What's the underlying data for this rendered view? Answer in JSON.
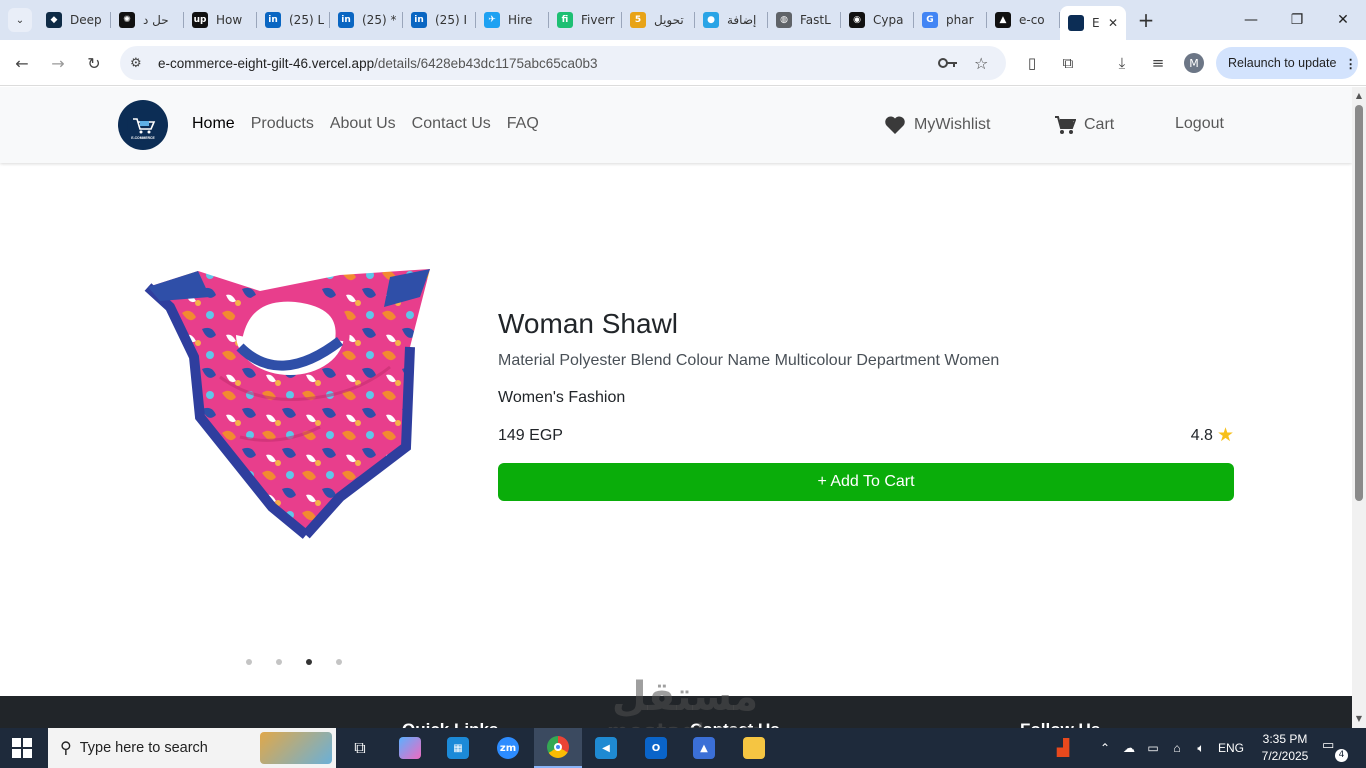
{
  "browser": {
    "tabs": [
      {
        "label": "Deep",
        "icon": "deepl-icon",
        "color": "#0f2b46",
        "glyph": "◆"
      },
      {
        "label": "حل د",
        "icon": "chatgpt-icon",
        "color": "#111111",
        "glyph": "✺"
      },
      {
        "label": "How",
        "icon": "upwork-icon",
        "color": "#111111",
        "glyph": "up"
      },
      {
        "label": "(25) L",
        "icon": "linkedin-icon",
        "color": "#0a66c2",
        "glyph": "in"
      },
      {
        "label": "(25) *",
        "icon": "linkedin-icon",
        "color": "#0a66c2",
        "glyph": "in"
      },
      {
        "label": "(25) I",
        "icon": "linkedin-icon",
        "color": "#0a66c2",
        "glyph": "in"
      },
      {
        "label": "Hire",
        "icon": "hire-icon",
        "color": "#1da1f2",
        "glyph": "✈"
      },
      {
        "label": "Fiverr",
        "icon": "fiverr-icon",
        "color": "#1dbf73",
        "glyph": "fi"
      },
      {
        "label": "تحويل",
        "icon": "khamsat-icon",
        "color": "#e8a317",
        "glyph": "5"
      },
      {
        "label": "إضافة",
        "icon": "mostaql-icon",
        "color": "#2aa4e6",
        "glyph": "●"
      },
      {
        "label": "FastL",
        "icon": "globe-icon",
        "color": "#5f6368",
        "glyph": "◍"
      },
      {
        "label": "Cypa",
        "icon": "github-icon",
        "color": "#111111",
        "glyph": "◉"
      },
      {
        "label": "phar",
        "icon": "google-icon",
        "color": "#4285f4",
        "glyph": "G"
      },
      {
        "label": "e-co",
        "icon": "vercel-icon",
        "color": "#111111",
        "glyph": "▲"
      }
    ],
    "active_tab": {
      "label": "E",
      "icon": "ecommerce-tab-icon",
      "color": "#0c2d55"
    },
    "url_host": "e-commerce-eight-gilt-46.vercel.app",
    "url_path": "/details/6428eb43dc1175abc65ca0b3",
    "avatar_letter": "M",
    "relaunch_label": "Relaunch to update"
  },
  "site": {
    "nav": {
      "links": [
        "Home",
        "Products",
        "About Us",
        "Contact Us",
        "FAQ"
      ],
      "active": "Home",
      "wishlist": "MyWishlist",
      "cart": "Cart",
      "logout": "Logout"
    },
    "logo_text": "E-COMMERCE"
  },
  "product": {
    "title": "Woman Shawl",
    "description": "Material Polyester Blend Colour Name Multicolour Department Women",
    "category": "Women's Fashion",
    "price": "149 EGP",
    "rating": "4.8",
    "add_to_cart": "+ Add To Cart",
    "slider_dots": 4,
    "active_dot": 3,
    "accent_color": "#0aad0a",
    "star_color": "#f7c01a"
  },
  "footer": {
    "headings": [
      "Quick Links",
      "Contact Us",
      "Follow Us"
    ]
  },
  "watermark": {
    "arabic": "مستقل",
    "latin": "mostaql.com"
  },
  "taskbar": {
    "search_placeholder": "Type here to search",
    "language": "ENG",
    "time": "3:35 PM",
    "date": "7/2/2025",
    "notifications": "4"
  }
}
